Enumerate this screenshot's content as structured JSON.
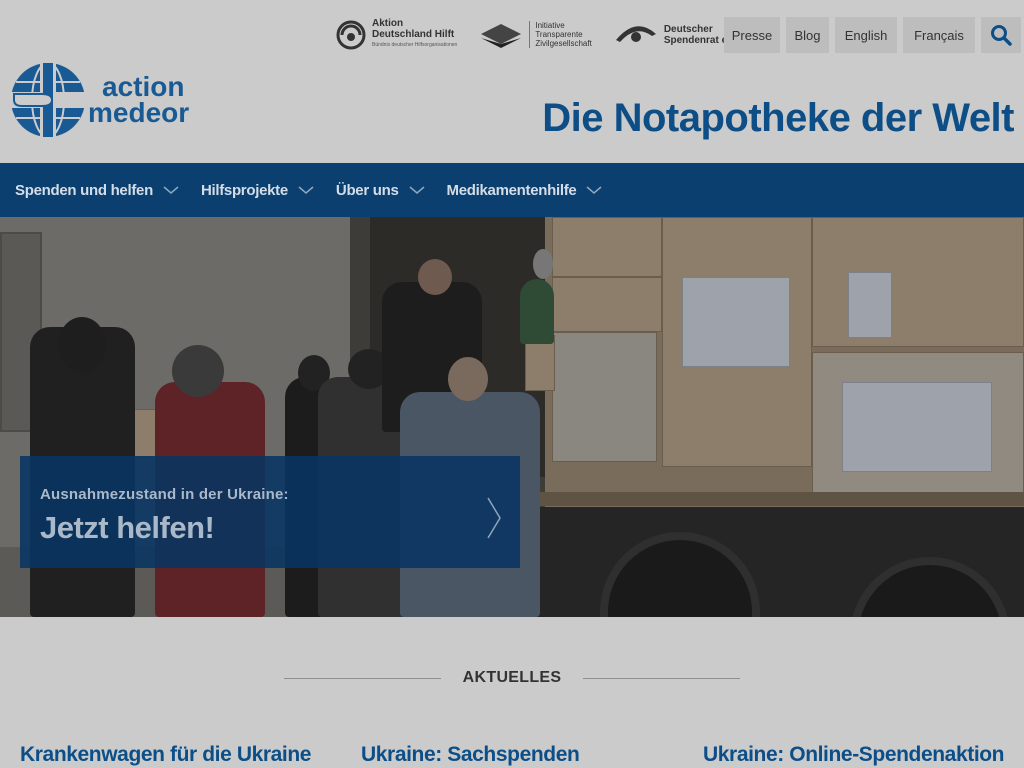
{
  "partners": [
    {
      "name": "Aktion Deutschland Hilft",
      "sub": "Bündnis deutscher Hilfsorganisationen",
      "icon": "aktion-deutschland-hilft-logo"
    },
    {
      "name": "Initiative Transparente Zivilgesellschaft",
      "icon": "transparente-zivilgesellschaft-logo"
    },
    {
      "name": "Deutscher Spendenrat e.V.",
      "icon": "deutscher-spendenrat-logo"
    }
  ],
  "partner_lines": {
    "adh_1": "Aktion",
    "adh_2": "Deutschland Hilft",
    "adh_sub": "Bündnis deutscher Hilfsorganisationen",
    "itz_1": "Initiative",
    "itz_2": "Transparente",
    "itz_3": "Zivilgesellschaft",
    "dsr_1": "Deutscher",
    "dsr_2": "Spendenrat e.V."
  },
  "util_links": {
    "presse": "Presse",
    "blog": "Blog",
    "english": "English",
    "francais": "Français"
  },
  "logo": {
    "line1": "action",
    "line2": "medeor"
  },
  "tagline": "Die Notapotheke der Welt",
  "nav": {
    "item1": "Spenden und helfen",
    "item2": "Hilfsprojekte",
    "item3": "Über uns",
    "item4": "Medikamentenhilfe"
  },
  "hero": {
    "kicker": "Ausnahmezustand in der Ukraine:",
    "headline": "Jetzt helfen!"
  },
  "news": {
    "heading": "AKTUELLES",
    "items": [
      {
        "title": "Krankenwagen für die Ukraine"
      },
      {
        "title": "Ukraine: Sachspenden"
      },
      {
        "title": "Ukraine: Online-Spendenaktion"
      }
    ]
  },
  "colors": {
    "brand_blue": "#0e4e86",
    "nav_bg": "#0a3f6f",
    "page_bg": "#cbcbcb"
  }
}
